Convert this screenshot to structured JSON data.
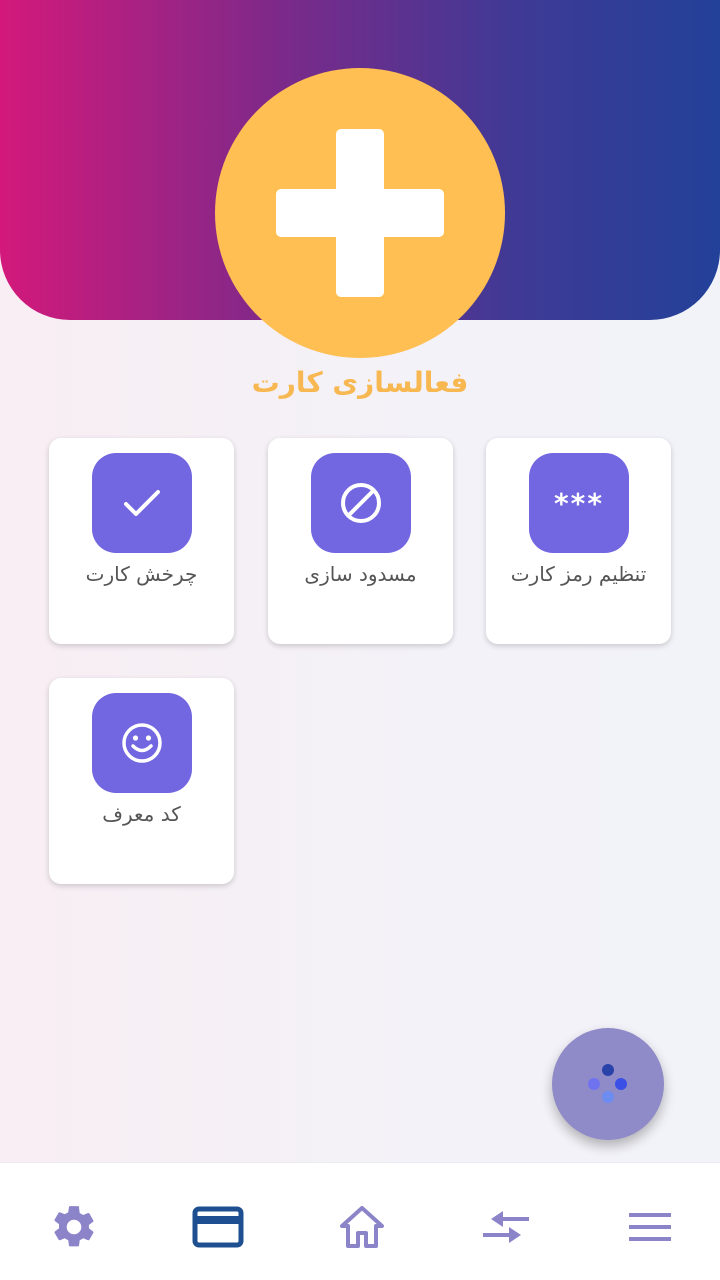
{
  "activate": {
    "label": "فعالسازی کارت"
  },
  "cards": [
    {
      "label": "تنظیم رمز کارت",
      "icon": "password-stars-icon",
      "glyph": "***"
    },
    {
      "label": "مسدود سازی",
      "icon": "block-icon"
    },
    {
      "label": "چرخش کارت",
      "icon": "check-icon"
    },
    {
      "label": "کد معرف",
      "icon": "smiley-icon"
    }
  ],
  "bottom_nav": [
    {
      "name": "settings",
      "icon": "gear-icon"
    },
    {
      "name": "cards",
      "icon": "credit-card-icon",
      "active": true
    },
    {
      "name": "home",
      "icon": "home-icon"
    },
    {
      "name": "transfer",
      "icon": "transfer-arrows-icon"
    },
    {
      "name": "menu",
      "icon": "hamburger-menu-icon"
    }
  ],
  "colors": {
    "header_gradient": [
      "#d3197b",
      "#234199"
    ],
    "accent_orange": "#ffbf52",
    "tile_purple": "#7266e1",
    "nav_icon": "#8c84c9",
    "nav_active": "#1d4f91",
    "fab": "#8f8ac8"
  }
}
